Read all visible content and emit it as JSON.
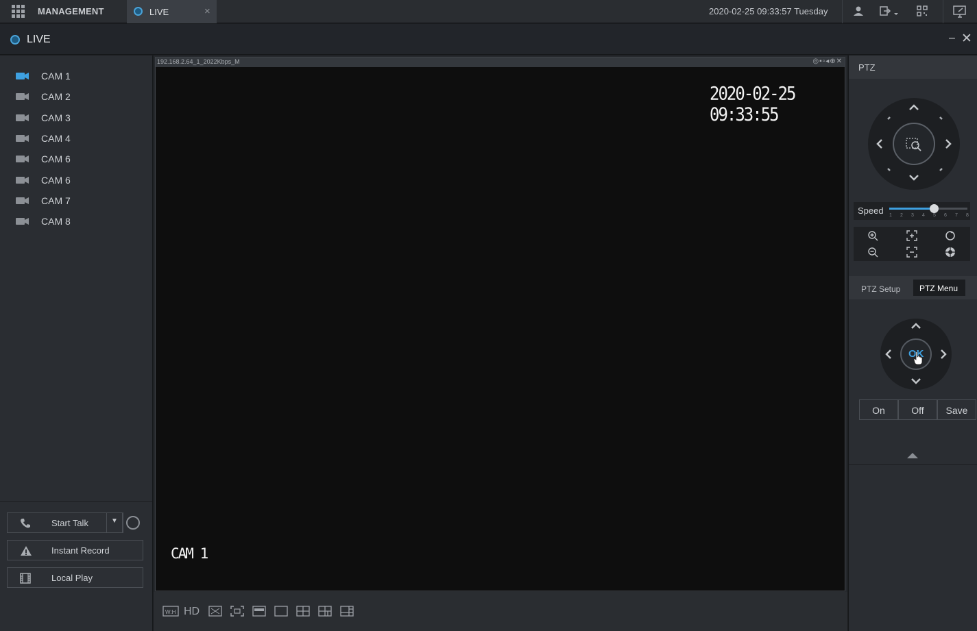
{
  "topbar": {
    "management_label": "MANAGEMENT",
    "tab_label": "LIVE",
    "tab_close": "×",
    "datetime": "2020-02-25 09:33:57 Tuesday"
  },
  "livebar": {
    "title": "LIVE",
    "minimize": "–",
    "close": "✕"
  },
  "cameras": [
    {
      "label": "CAM 1",
      "active": true
    },
    {
      "label": "CAM 2",
      "active": false
    },
    {
      "label": "CAM 3",
      "active": false
    },
    {
      "label": "CAM 4",
      "active": false
    },
    {
      "label": "CAM 6",
      "active": false
    },
    {
      "label": "CAM 6",
      "active": false
    },
    {
      "label": "CAM 7",
      "active": false
    },
    {
      "label": "CAM 8",
      "active": false
    }
  ],
  "left_buttons": {
    "start_talk": "Start Talk",
    "instant_record": "Instant Record",
    "local_play": "Local Play"
  },
  "video": {
    "stream_info": "192.168.2.64_1_2022Kbps_M",
    "header_icons": "◎▪▫◂⊕✕",
    "osd_time": "2020-02-25 09:33:55",
    "osd_camera": "CAM 1"
  },
  "video_toolbar": {
    "hd_label": "HD",
    "wh_label": "W:H"
  },
  "ptz": {
    "header": "PTZ",
    "speed_label": "Speed",
    "speed_value": 5,
    "speed_ticks": [
      "1",
      "2",
      "3",
      "4",
      "5",
      "6",
      "7",
      "8"
    ],
    "tab_setup": "PTZ Setup",
    "tab_menu": "PTZ Menu",
    "ok_label": "OK",
    "btn_on": "On",
    "btn_off": "Off",
    "btn_save": "Save"
  },
  "colors": {
    "accent": "#3ea0e0",
    "active_cam": "#3ea0e0"
  }
}
